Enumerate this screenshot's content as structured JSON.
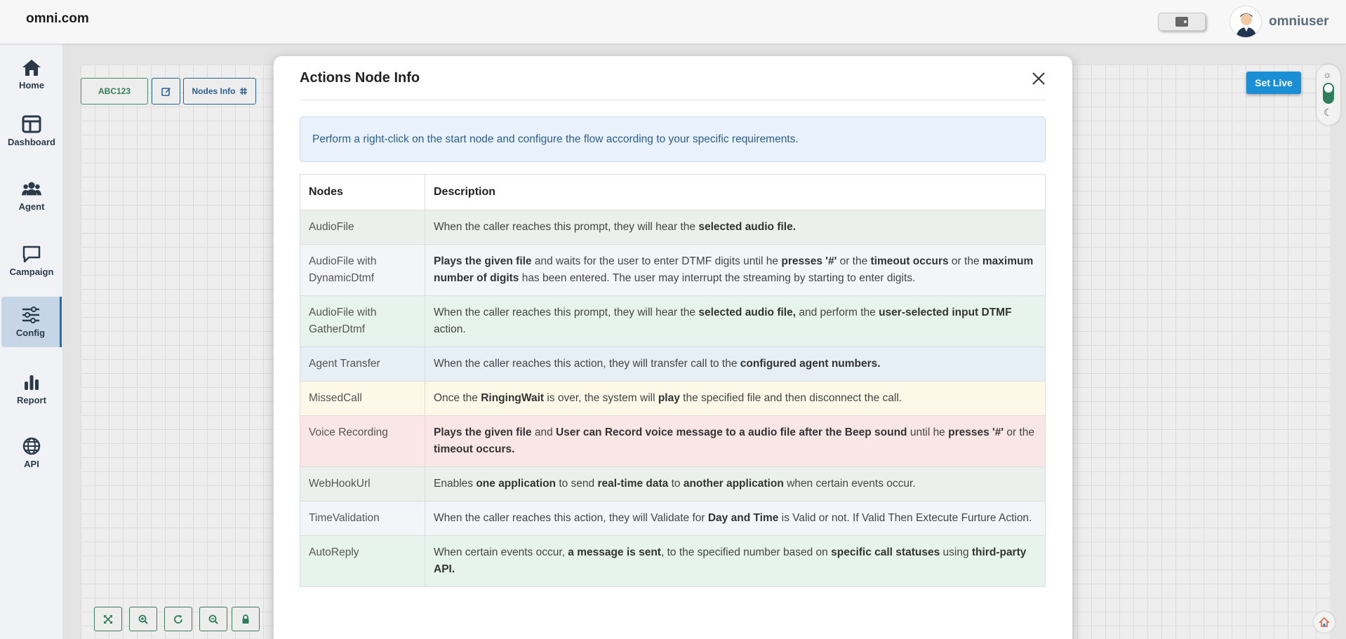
{
  "header": {
    "brand": "omni.com",
    "username": "omniuser"
  },
  "sidebar": {
    "items": [
      {
        "label": "Home",
        "icon": "home-icon"
      },
      {
        "label": "Dashboard",
        "icon": "dashboard-icon"
      },
      {
        "label": "Agent",
        "icon": "users-icon"
      },
      {
        "label": "Campaign",
        "icon": "chat-icon"
      },
      {
        "label": "Config",
        "icon": "sliders-icon",
        "active": true
      },
      {
        "label": "Report",
        "icon": "bar-chart-icon"
      },
      {
        "label": "API",
        "icon": "globe-icon"
      }
    ]
  },
  "flow_toolbar": {
    "flow_name": "ABC123",
    "nodes_info_label": "Nodes Info"
  },
  "set_live_label": "Set Live",
  "modal": {
    "title": "Actions Node Info",
    "info": "Perform a right-click on the start node and configure the flow according to your specific requirements.",
    "columns": [
      "Nodes",
      "Description"
    ],
    "rows": [
      {
        "node": "AudioFile",
        "parts": [
          "When the caller reaches this prompt, they will hear the ",
          "selected audio file."
        ]
      },
      {
        "node": "AudioFile with DynamicDtmf",
        "parts": [
          "Plays the given file",
          " and waits for the user to enter DTMF digits until he ",
          "presses '#'",
          " or the ",
          "timeout occurs",
          " or the ",
          "maximum number of digits",
          " has been entered. The user may interrupt the streaming by starting to enter digits."
        ]
      },
      {
        "node": "AudioFile with GatherDtmf",
        "parts": [
          "When the caller reaches this prompt, they will hear the ",
          "selected audio file,",
          " and perform the ",
          "user-selected input DTMF",
          " action."
        ]
      },
      {
        "node": "Agent Transfer",
        "parts": [
          "When the caller reaches this action, they will transfer call to the ",
          "configured agent numbers."
        ]
      },
      {
        "node": "MissedCall",
        "parts": [
          "Once the ",
          "RingingWait",
          " is over, the system will ",
          "play",
          " the specified file and then disconnect the call."
        ]
      },
      {
        "node": "Voice Recording",
        "parts": [
          "",
          "Plays the given file",
          " and ",
          "User can Record voice message to a audio file after the Beep sound",
          " until he ",
          "presses '#'",
          " or the ",
          "timeout occurs."
        ]
      },
      {
        "node": "WebHookUrl",
        "parts": [
          "Enables ",
          "one application",
          " to send ",
          "real-time data",
          " to ",
          "another application",
          " when certain events occur."
        ]
      },
      {
        "node": "TimeValidation",
        "parts": [
          "When the caller reaches this action, they will Validate for ",
          "Day and Time",
          " is Valid or not. If Valid Then Extecute Furture Action."
        ]
      },
      {
        "node": "AutoReply",
        "parts": [
          "When certain events occur, ",
          "a message is sent",
          ", to the specified number based on ",
          "specific call statuses",
          " using ",
          "third-party API."
        ]
      }
    ]
  }
}
